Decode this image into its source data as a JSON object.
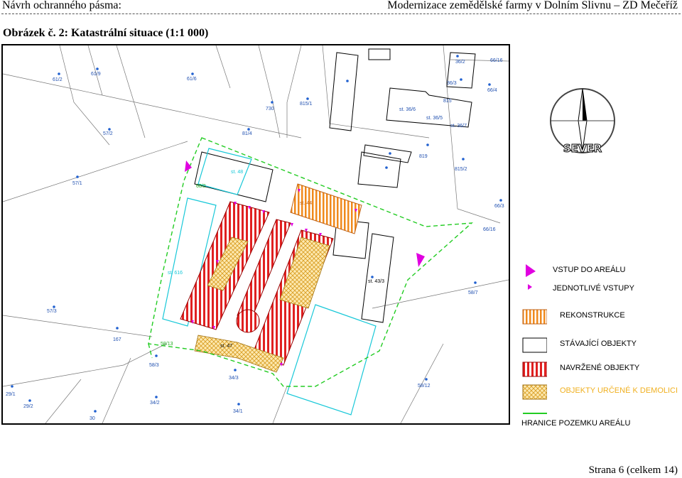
{
  "header": {
    "left": "Návrh ochranného pásma:",
    "right": "Modernizace zemědělské farmy v Dolním Slivnu – ZD Mečeříž"
  },
  "caption": "Obrázek č. 2: Katastrální situace (1:1 000)",
  "map": {
    "parcels": [
      "61/2",
      "61/9",
      "61/6",
      "730",
      "815/1",
      "57/2",
      "81/4",
      "57/1",
      "68/2",
      "66/16",
      "36/2",
      "36/3",
      "66/4",
      "st. 36/6",
      "815",
      "st. 36/5",
      "st. 36/7",
      "819",
      "815/2",
      "66/3",
      "66/16",
      "st. 48",
      "st. 44",
      "st. 616",
      "58/7",
      "57/3",
      "st. 43/3",
      "167",
      "58/13",
      "58/3",
      "34/3",
      "29/1",
      "29/2",
      "30",
      "34/2",
      "34/1",
      "58/12",
      "st. 47"
    ],
    "compass_label": "SEVER"
  },
  "legend": {
    "items": [
      {
        "label": "VSTUP DO AREÁLU",
        "color": "#e000e0"
      },
      {
        "label": "JEDNOTLIVÉ VSTUPY",
        "color": "#e000e0"
      },
      {
        "label": "REKONSTRUKCE",
        "color": "#f08a1c"
      },
      {
        "label": "STÁVAJÍCÍ OBJEKTY",
        "color": "#000000"
      },
      {
        "label": "NAVRŽENÉ OBJEKTY",
        "color": "#e02020"
      },
      {
        "label": "OBJEKTY URČENÉ K DEMOLICI",
        "color": "#f0b020"
      },
      {
        "label": "HRANICE POZEMKU AREÁLU",
        "color": "#22cc22"
      }
    ]
  },
  "footer": "Strana 6 (celkem 14)"
}
